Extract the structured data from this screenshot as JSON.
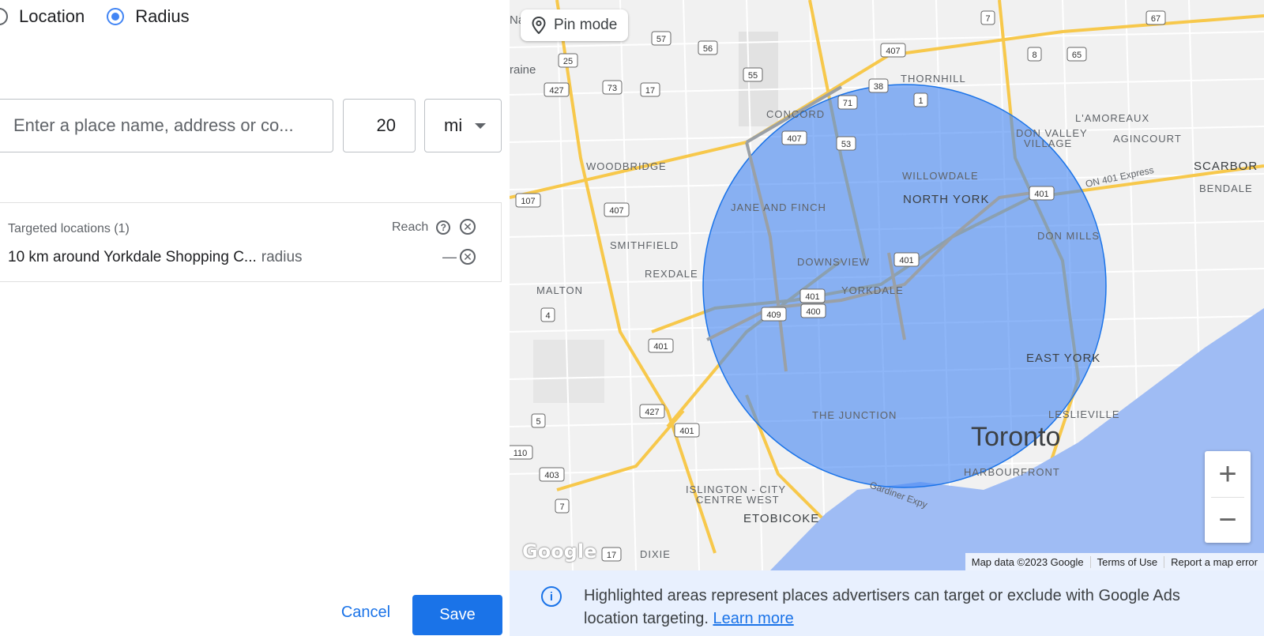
{
  "mode_selector": {
    "options": [
      {
        "label": "Location",
        "selected": false
      },
      {
        "label": "Radius",
        "selected": true
      }
    ]
  },
  "search": {
    "placeholder": "Enter a place name, address or co...",
    "radius_value": "20",
    "unit": "mi"
  },
  "targeted": {
    "header": "Targeted locations (1)",
    "reach_label": "Reach",
    "item_text": "10 km around Yorkdale Shopping C...",
    "item_kind": "radius",
    "item_reach": "—"
  },
  "map": {
    "pin_mode_label": "Pin mode",
    "labels": {
      "toronto": "Toronto",
      "north_york": "NORTH YORK",
      "willowdale": "WILLOWDALE",
      "thornhill": "THORNHILL",
      "concord": "CONCORD",
      "woodbridge": "WOODBRIDGE",
      "jane_finch": "JANE AND FINCH",
      "smithfield": "SMITHFIELD",
      "downsview": "DOWNSVIEW",
      "rexdale": "REXDALE",
      "malton": "MALTON",
      "yorkdale": "YORKDALE",
      "east_york": "EAST YORK",
      "don_mills": "DON MILLS",
      "lamoureaux": "L'AMOREAUX",
      "agincourt": "AGINCOURT",
      "don_valley_1": "DON VALLEY",
      "don_valley_2": "VILLAGE",
      "scarboro": "SCARBOR",
      "bendale": "BENDALE",
      "junction": "THE JUNCTION",
      "leslieville": "LESLIEVILLE",
      "harbourfront": "HARBOURFRONT",
      "islington_1": "ISLINGTON - CITY",
      "islington_2": "CENTRE WEST",
      "etobicoke": "ETOBICOKE",
      "dixie": "DIXIE",
      "raine": "raine",
      "na": "Na",
      "express": "ON 401 Express",
      "gardiner": "Gardiner Expy"
    },
    "shields": [
      "57",
      "56",
      "25",
      "55",
      "427",
      "73",
      "17",
      "38",
      "407",
      "7",
      "8",
      "65",
      "67",
      "1",
      "71",
      "407",
      "53",
      "407",
      "107",
      "401",
      "401",
      "400",
      "409",
      "401",
      "427",
      "401",
      "403",
      "7",
      "4",
      "5",
      "110",
      "17",
      "401"
    ],
    "attribution": {
      "map_data": "Map data ©2023 Google",
      "terms": "Terms of Use",
      "report": "Report a map error"
    },
    "logo": "Google",
    "zoom_in": "+",
    "zoom_out": "−"
  },
  "info": {
    "text": "Highlighted areas represent places advertisers can target or exclude with Google Ads location targeting.",
    "link": "Learn more"
  },
  "actions": {
    "cancel": "Cancel",
    "save": "Save"
  },
  "colors": {
    "primary": "#1a73e8",
    "radius_fill": "#4285f4",
    "water": "#9fbcf4",
    "highway": "#f7c84b"
  }
}
